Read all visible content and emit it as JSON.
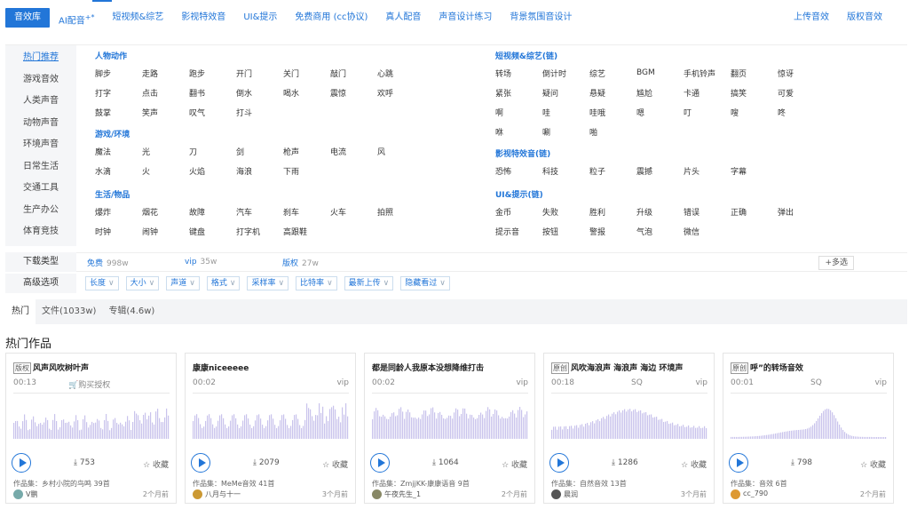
{
  "nav": {
    "tabs": [
      "音效库",
      "AI配音",
      "短视频&综艺",
      "影视特效音",
      "UI&提示",
      "免费商用 (cc协议)",
      "真人配音",
      "声音设计练习",
      "背景氛围音设计"
    ],
    "ai_sup": "+*",
    "right": [
      "上传音效",
      "版权音效"
    ],
    "accent": "#2276d8"
  },
  "sidebar": [
    "热门推荐",
    "游戏音效",
    "人类声音",
    "动物声音",
    "环境声音",
    "日常生活",
    "交通工具",
    "生产办公",
    "体育竞技"
  ],
  "groups_left": [
    {
      "title": "人物动作",
      "rows": [
        [
          "脚步",
          "走路",
          "跑步",
          "开门",
          "关门",
          "敲门",
          "心跳"
        ],
        [
          "打字",
          "点击",
          "翻书",
          "倒水",
          "喝水",
          "震惊",
          "欢呼"
        ],
        [
          "鼓掌",
          "笑声",
          "叹气",
          "打斗"
        ]
      ]
    },
    {
      "title": "游戏/环境",
      "rows": [
        [
          "魔法",
          "光",
          "刀",
          "剑",
          "枪声",
          "电流",
          "风"
        ],
        [
          "水滴",
          "火",
          "火焰",
          "海浪",
          "下雨"
        ]
      ]
    },
    {
      "title": "生活/物品",
      "rows": [
        [
          "爆炸",
          "烟花",
          "故障",
          "汽车",
          "刹车",
          "火车",
          "拍照"
        ],
        [
          "时钟",
          "闹钟",
          "键盘",
          "打字机",
          "高跟鞋"
        ]
      ]
    }
  ],
  "groups_right": [
    {
      "title": "短视频&综艺(链)",
      "rows": [
        [
          "转场",
          "倒计时",
          "综艺",
          "BGM",
          "手机铃声",
          "翻页",
          "惊讶"
        ],
        [
          "紧张",
          "疑问",
          "悬疑",
          "尴尬",
          "卡通",
          "搞笑",
          "可爱"
        ],
        [
          "啊",
          "哇",
          "哇哦",
          "嗯",
          "叮",
          "嗖",
          "咚"
        ],
        [
          "咻",
          "唰",
          "啪"
        ]
      ]
    },
    {
      "title": "影视特效音(链)",
      "rows": [
        [
          "恐怖",
          "科技",
          "粒子",
          "震撼",
          "片头",
          "字幕"
        ]
      ]
    },
    {
      "title": "UI&提示(链)",
      "rows": [
        [
          "金币",
          "失败",
          "胜利",
          "升级",
          "错误",
          "正确",
          "弹出"
        ],
        [
          "提示音",
          "按钮",
          "警报",
          "气泡",
          "微信"
        ]
      ]
    }
  ],
  "download": {
    "label": "下载类型",
    "options": [
      {
        "name": "免费",
        "count": "998w"
      },
      {
        "name": "vip",
        "count": "35w"
      },
      {
        "name": "版权",
        "count": "27w"
      }
    ],
    "multi": "+多选"
  },
  "advanced": {
    "label": "高级选项",
    "dropdowns": [
      "长度",
      "大小",
      "声道",
      "格式",
      "采样率",
      "比特率",
      "最新上传",
      "隐藏看过"
    ]
  },
  "content_tabs": [
    "热门",
    "文件(1033w)",
    "专辑(4.6w)"
  ],
  "section_title": "热门作品",
  "cards": [
    {
      "badge": "版权",
      "title": "风声风吹树叶声",
      "duration": "00:13",
      "mid": "🛒购买授权",
      "quality": "",
      "tag": "",
      "downloads": "753",
      "fav": "☆ 收藏",
      "collection": "作品集：乡村小院的鸟鸣 39首",
      "user": "V鹏",
      "time": "2个月前",
      "avatar": "#7aa"
    },
    {
      "badge": "",
      "title": "康康niceeeee",
      "duration": "00:02",
      "mid": "",
      "quality": "",
      "tag": "vip",
      "downloads": "2079",
      "fav": "☆ 收藏",
      "collection": "作品集：MeMe音效 41首",
      "user": "八月与十一",
      "time": "3个月前",
      "avatar": "#c93"
    },
    {
      "badge": "",
      "title": "都是同龄人我原本没想降维打击",
      "duration": "00:02",
      "mid": "",
      "quality": "",
      "tag": "vip",
      "downloads": "1064",
      "fav": "☆ 收藏",
      "collection": "作品集：ZmjjKK-康康语音 9首",
      "user": "午夜先生_1",
      "time": "2个月前",
      "avatar": "#886"
    },
    {
      "badge": "原创",
      "title": "风吹海浪声 海浪声 海边 环境声",
      "duration": "00:18",
      "mid": "",
      "quality": "SQ",
      "tag": "vip",
      "downloads": "1286",
      "fav": "☆ 收藏",
      "collection": "作品集：自然音效 13首",
      "user": "晨润",
      "time": "3个月前",
      "avatar": "#555"
    },
    {
      "badge": "原创",
      "title": "呼”的转场音效",
      "duration": "00:01",
      "mid": "",
      "quality": "SQ",
      "tag": "vip",
      "downloads": "798",
      "fav": "☆ 收藏",
      "collection": "作品集：音效 6首",
      "user": "cc_790",
      "time": "2个月前",
      "avatar": "#d93"
    }
  ],
  "wave_color": "#c9c3ec"
}
